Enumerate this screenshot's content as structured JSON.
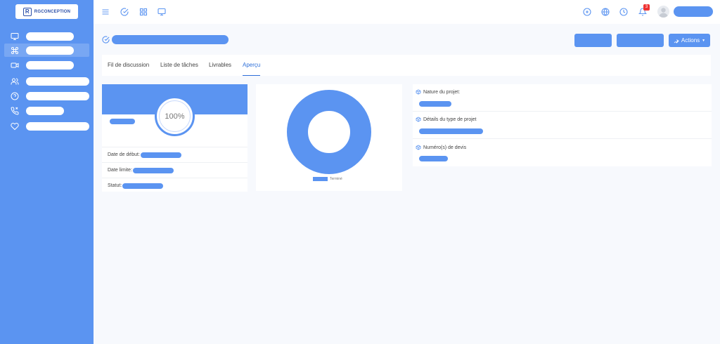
{
  "brand": {
    "logo_text": "RGCONCEPTION",
    "logo_mark": "R"
  },
  "sidebar": {
    "items": [
      {
        "icon": "monitor-icon"
      },
      {
        "icon": "command-icon",
        "active": true
      },
      {
        "icon": "video-icon"
      },
      {
        "icon": "users-icon"
      },
      {
        "icon": "help-icon"
      },
      {
        "icon": "phone-icon"
      },
      {
        "icon": "heart-icon"
      }
    ]
  },
  "topbar": {
    "left_icons": [
      "menu-icon",
      "check-circle-icon",
      "grid-icon",
      "monitor-icon"
    ],
    "right_icons": [
      "plus-circle-icon",
      "globe-icon",
      "clock-icon",
      "bell-icon"
    ],
    "notification_count": "3"
  },
  "toolbar": {
    "actions_label": "Actions"
  },
  "tabs": [
    {
      "label": "Fil de discussion"
    },
    {
      "label": "Liste de tâches"
    },
    {
      "label": "Livrables"
    },
    {
      "label": "Aperçu",
      "active": true
    }
  ],
  "progress": {
    "percent_label": "100%",
    "value": 1.0,
    "rows": [
      {
        "label": "Date de début:"
      },
      {
        "label": "Date limite:"
      },
      {
        "label": "Statut:"
      }
    ]
  },
  "chart_data": {
    "type": "pie",
    "categories": [
      "Terminé"
    ],
    "values": [
      100
    ],
    "legend": "bottom"
  },
  "project_info": {
    "fields": [
      {
        "label": "Nature du projet:"
      },
      {
        "label": "Détails du type de projet"
      },
      {
        "label": "Numéro(s) de devis"
      }
    ]
  },
  "colors": {
    "primary": "#5b94f1",
    "accent": "#2d6fd9",
    "badge": "#ee3333"
  }
}
